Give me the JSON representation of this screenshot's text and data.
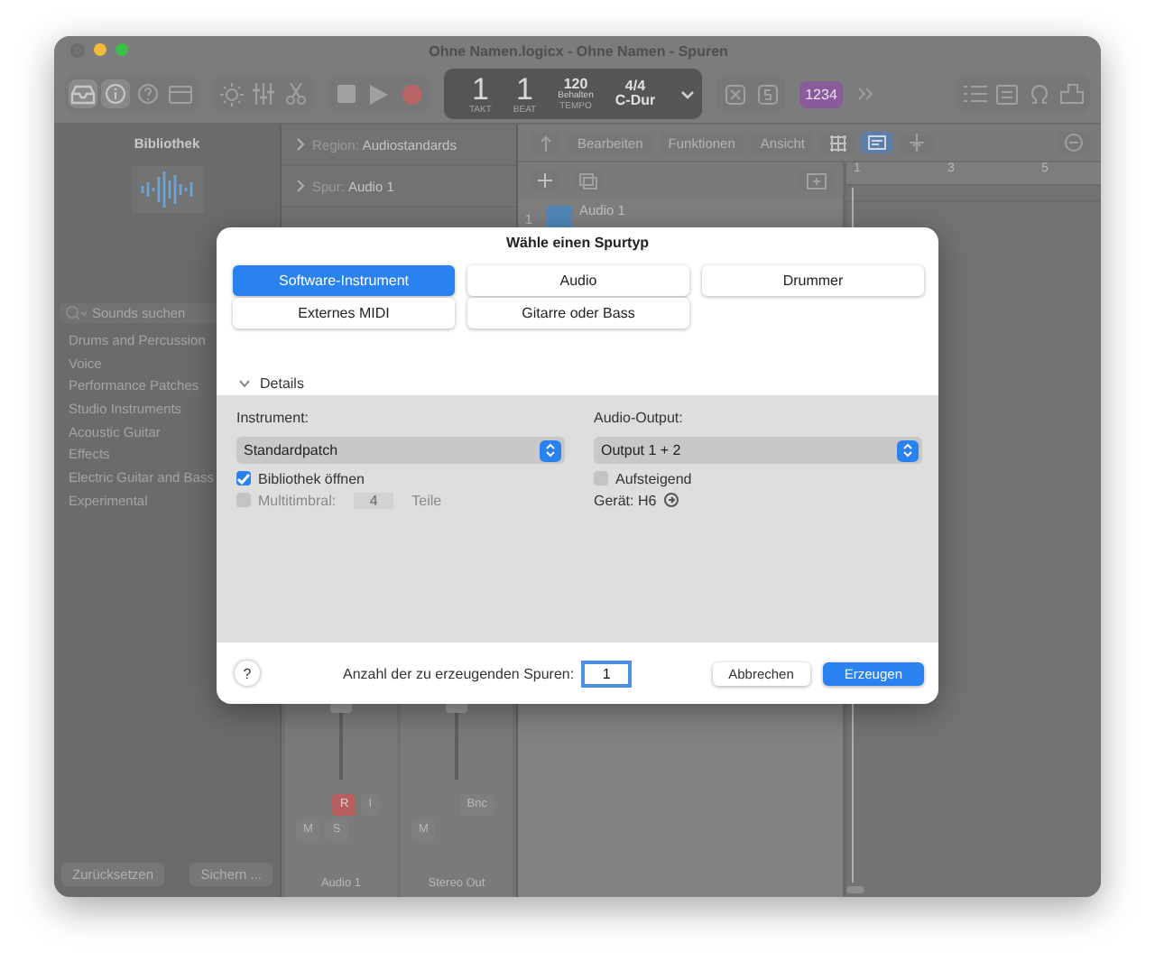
{
  "window": {
    "title": "Ohne Namen.logicx - Ohne Namen - Spuren"
  },
  "transport": {
    "bar": "1",
    "beat": "1",
    "bar_label": "TAKT",
    "beat_label": "BEAT",
    "tempo": "120",
    "tempo_mode": "Behalten",
    "tempo_label": "TEMPO",
    "signature": "4/4",
    "key": "C-Dur",
    "counter": "1234"
  },
  "library": {
    "title": "Bibliothek",
    "search": {
      "placeholder": "Sounds suchen"
    },
    "categories": [
      "Drums and Percussion",
      "Voice",
      "Performance Patches",
      "Studio Instruments",
      "Acoustic Guitar",
      "Effects",
      "Electric Guitar and Bass",
      "Experimental"
    ],
    "buttons": [
      "Zurücksetzen",
      "Sichern ..."
    ]
  },
  "inspector": {
    "region": {
      "label": "Region:",
      "value": "Audiostandards"
    },
    "track": {
      "label": "Spur:",
      "value": "Audio 1"
    }
  },
  "mixer": {
    "strips": [
      {
        "name": "Audio 1",
        "buttons": [
          {
            "label": "R",
            "on": true
          },
          {
            "label": "I",
            "on": false
          }
        ],
        "mute": "M",
        "solo": "S"
      },
      {
        "name": "Stereo Out",
        "buttons": [
          {
            "label": "Bnc",
            "on": false
          }
        ],
        "mute": "M"
      }
    ]
  },
  "tracks": {
    "menus": [
      "Bearbeiten",
      "Funktionen",
      "Ansicht"
    ],
    "ruler": [
      "1",
      "3",
      "5"
    ],
    "rows": [
      {
        "number": "1",
        "name": "Audio 1"
      }
    ]
  },
  "dialog": {
    "title": "Wähle einen Spurtyp",
    "track_types": [
      {
        "label": "Software-Instrument",
        "selected": true
      },
      {
        "label": "Audio",
        "selected": false
      },
      {
        "label": "Drummer",
        "selected": false
      },
      {
        "label": "Externes MIDI",
        "selected": false
      },
      {
        "label": "Gitarre oder Bass",
        "selected": false
      }
    ],
    "details": {
      "label": "Details",
      "expanded": true
    },
    "instrument": {
      "label": "Instrument:",
      "value": "Standardpatch"
    },
    "open_library": {
      "label": "Bibliothek öffnen",
      "checked": true
    },
    "multitimbral": {
      "label": "Multitimbral:",
      "checked": false,
      "value": "4",
      "unit": "Teile"
    },
    "audio_output": {
      "label": "Audio-Output:",
      "value": "Output 1 + 2"
    },
    "ascending": {
      "label": "Aufsteigend",
      "checked": false
    },
    "device": "Gerät: H6",
    "help": "?",
    "count": {
      "label": "Anzahl der zu erzeugenden Spuren:",
      "value": "1"
    },
    "buttons": [
      {
        "label": "Abbrechen",
        "kind": "secondary"
      },
      {
        "label": "Erzeugen",
        "kind": "primary"
      }
    ]
  }
}
